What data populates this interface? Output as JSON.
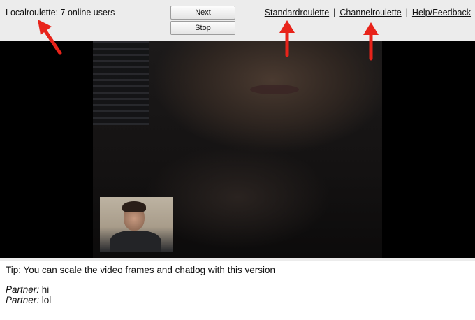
{
  "toolbar": {
    "status": "Localroulette: 7 online users",
    "next_label": "Next",
    "stop_label": "Stop",
    "links": [
      "Standardroulette",
      "Channelroulette",
      "Help/Feedback"
    ],
    "separator": "|"
  },
  "chat": {
    "tip": "Tip: You can scale the video frames and chatlog with this version",
    "messages": [
      {
        "sender": "Partner:",
        "text": "hi"
      },
      {
        "sender": "Partner:",
        "text": "lol"
      }
    ]
  },
  "colors": {
    "annotation_arrow": "#e8231a"
  }
}
